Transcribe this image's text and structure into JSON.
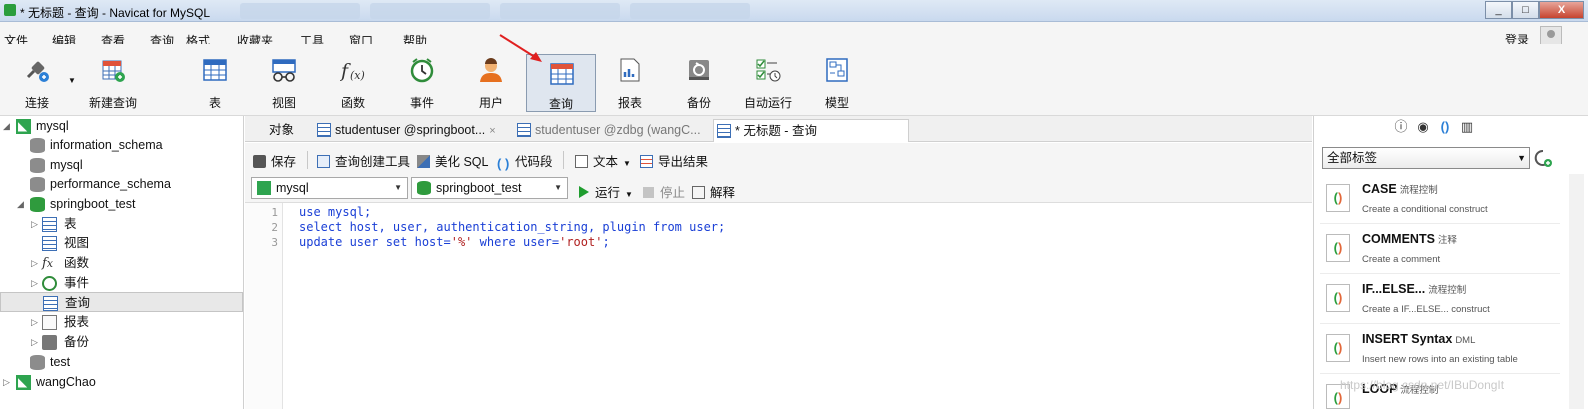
{
  "window": {
    "title": "* 无标题 - 查询 - Navicat for MySQL",
    "controls": [
      "_",
      "□",
      "X"
    ]
  },
  "menu": [
    "文件",
    "编辑",
    "查看",
    "查询",
    "格式",
    "收藏夹",
    "工具",
    "窗口",
    "帮助"
  ],
  "login_label": "登录",
  "toolbar": [
    {
      "label": "连接",
      "icon": "plug-connect-icon"
    },
    {
      "label": "新建查询",
      "icon": "new-query-icon"
    },
    {
      "label": "表",
      "icon": "table-icon"
    },
    {
      "label": "视图",
      "icon": "view-icon"
    },
    {
      "label": "函数",
      "icon": "function-icon"
    },
    {
      "label": "事件",
      "icon": "event-clock-icon"
    },
    {
      "label": "用户",
      "icon": "user-icon"
    },
    {
      "label": "查询",
      "icon": "query-icon",
      "active": true
    },
    {
      "label": "报表",
      "icon": "report-icon"
    },
    {
      "label": "备份",
      "icon": "backup-icon"
    },
    {
      "label": "自动运行",
      "icon": "auto-run-icon"
    },
    {
      "label": "模型",
      "icon": "model-icon"
    }
  ],
  "tree": {
    "conn1": "mysql",
    "db1": "information_schema",
    "db2": "mysql",
    "db3": "performance_schema",
    "db4": "springboot_test",
    "child1": "表",
    "child2": "视图",
    "child3": "函数",
    "child4": "事件",
    "child5": "查询",
    "child6": "报表",
    "child7": "备份",
    "db5": "test",
    "conn2": "wangChao"
  },
  "tabs": {
    "objects": "对象",
    "tab1": "studentuser @springboot...",
    "tab2": "studentuser @zdbg (wangC...",
    "tab3": "* 无标题 - 查询",
    "close": "×"
  },
  "editor_toolbar": {
    "save": "保存",
    "query_builder": "查询创建工具",
    "beautify": "美化 SQL",
    "snippet": "代码段",
    "text": "文本",
    "export": "导出结果"
  },
  "run_bar": {
    "connection": "mysql",
    "database": "springboot_test",
    "run": "运行",
    "stop": "停止",
    "explain": "解释"
  },
  "code": {
    "lines": [
      "1",
      "2",
      "3"
    ],
    "l1": "use mysql;",
    "l2": "select host, user, authentication_string, plugin from user;",
    "l3a": "update user set host=",
    "l3b": "'%'",
    "l3c": " where user=",
    "l3d": "'root'",
    "l3e": ";"
  },
  "right_panel": {
    "filter": "全部标签",
    "snippets": [
      {
        "title": "CASE",
        "tag": "流程控制",
        "desc": "Create a conditional construct"
      },
      {
        "title": "COMMENTS",
        "tag": "注释",
        "desc": "Create a comment"
      },
      {
        "title": "IF...ELSE...",
        "tag": "流程控制",
        "desc": "Create a IF...ELSE... construct"
      },
      {
        "title": "INSERT Syntax",
        "tag": "DML",
        "desc": "Insert new rows into an existing table"
      },
      {
        "title": "LOOP",
        "tag": "流程控制",
        "desc": ""
      }
    ]
  },
  "watermark": "https://blog.csdn.net/IBuDongIt",
  "colors": {
    "accent": "#3d6fb5",
    "run": "#1f9d2f",
    "keyword": "#1a3fd6",
    "string": "#b02020"
  }
}
